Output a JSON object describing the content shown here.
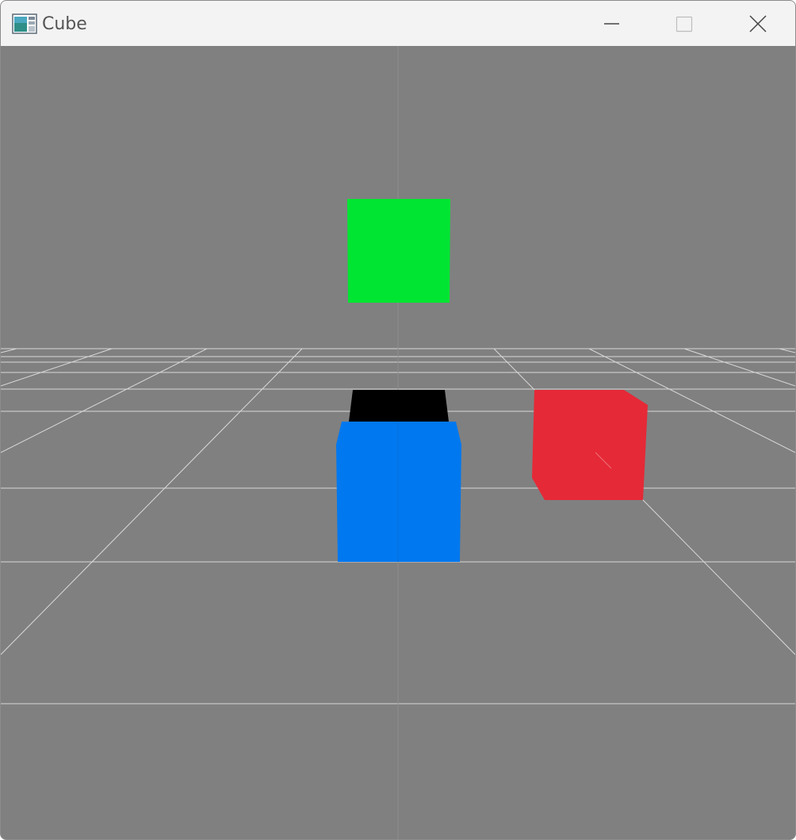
{
  "window": {
    "title": "Cube",
    "icon": "app-window-icon",
    "controls": [
      "minimize-icon",
      "maximize-icon",
      "close-icon"
    ]
  },
  "scene": {
    "background_color": "#808080",
    "grid_color": "#d8d8d8",
    "objects": [
      {
        "name": "green-cube",
        "color": "#00e532"
      },
      {
        "name": "blue-cube",
        "color": "#0078ef"
      },
      {
        "name": "blue-cube-top",
        "color": "#000000"
      },
      {
        "name": "red-cube",
        "color": "#e52937"
      }
    ]
  }
}
